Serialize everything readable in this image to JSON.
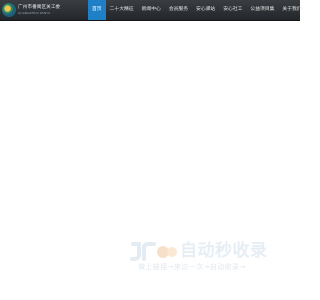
{
  "site": {
    "logo_text": "广州市番禺区关工委",
    "logo_subtext": "GUANGZHOU PANYU"
  },
  "nav": {
    "items": [
      {
        "label": "首页",
        "active": true
      },
      {
        "label": "二十大精征"
      },
      {
        "label": "新闻中心"
      },
      {
        "label": "会员服务"
      },
      {
        "label": "安心驿站"
      },
      {
        "label": "安心社工"
      },
      {
        "label": "公益项目集"
      },
      {
        "label": "关于我们"
      }
    ]
  },
  "watermark": {
    "title": "自动秒收录",
    "slogan": "做上链接→来访一次→自动收录→"
  },
  "colors": {
    "topbar": "#2b2e33",
    "active_nav": "#1f7fc7",
    "watermark": "#e6eef5"
  }
}
